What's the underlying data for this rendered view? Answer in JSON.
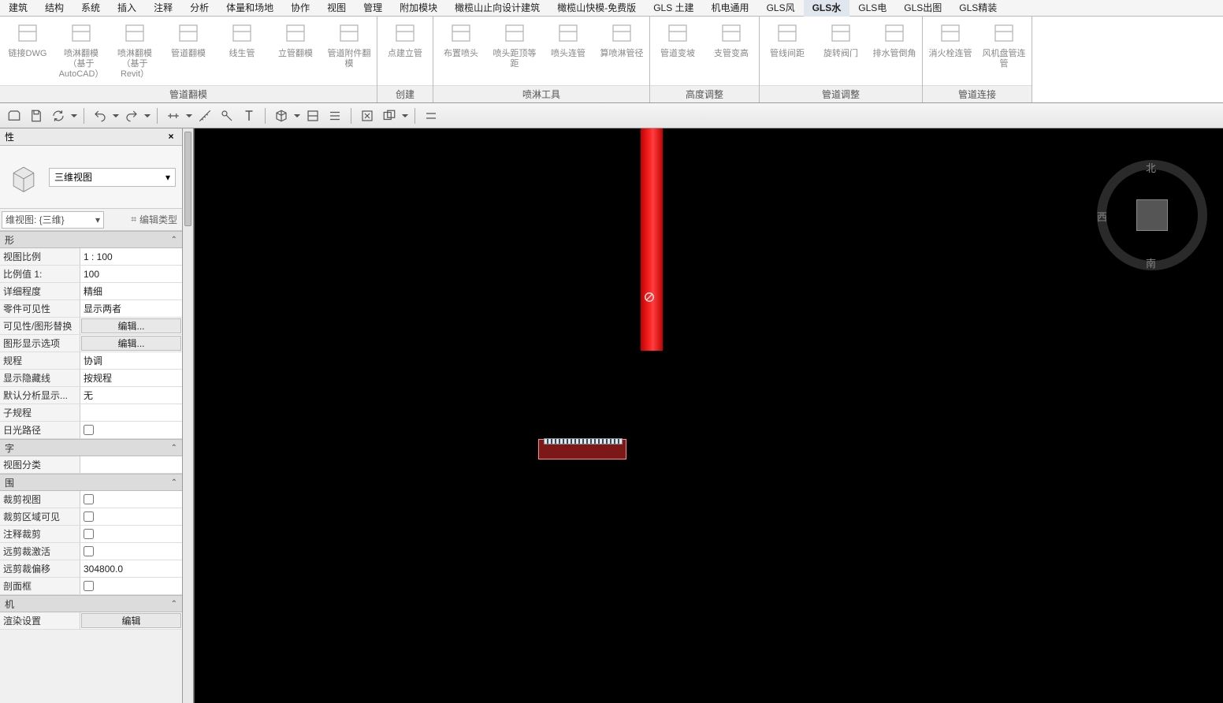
{
  "menu": {
    "items": [
      "建筑",
      "结构",
      "系统",
      "插入",
      "注释",
      "分析",
      "体量和场地",
      "协作",
      "视图",
      "管理",
      "附加模块",
      "橄榄山止向设计建筑",
      "橄榄山快模-免费版",
      "GLS 土建",
      "机电通用",
      "GLS风",
      "GLS水",
      "GLS电",
      "GLS出图",
      "GLS精装"
    ],
    "active": 16
  },
  "ribbon": {
    "groups": [
      {
        "label": "管道翻模",
        "buttons": [
          {
            "name": "link-dwg",
            "label": "链接DWG"
          },
          {
            "name": "spray-autocad",
            "label": "喷淋翻模\n（基于AutoCAD）"
          },
          {
            "name": "spray-revit",
            "label": "喷淋翻模\n（基于Revit）"
          },
          {
            "name": "pipe-flip",
            "label": "管道翻模"
          },
          {
            "name": "line-pipe",
            "label": "线生管"
          },
          {
            "name": "riser-flip",
            "label": "立管翻模"
          },
          {
            "name": "pipe-acc-flip",
            "label": "管道附件翻模"
          }
        ]
      },
      {
        "label": "创建",
        "buttons": [
          {
            "name": "point-riser",
            "label": "点建立管"
          }
        ]
      },
      {
        "label": "喷淋工具",
        "buttons": [
          {
            "name": "place-spray",
            "label": "布置喷头"
          },
          {
            "name": "spray-top-dist",
            "label": "喷头距顶等距"
          },
          {
            "name": "spray-connect",
            "label": "喷头连管"
          },
          {
            "name": "calc-spray-dia",
            "label": "算喷淋管径"
          }
        ]
      },
      {
        "label": "高度调整",
        "buttons": [
          {
            "name": "pipe-slope",
            "label": "管道变坡"
          },
          {
            "name": "branch-height",
            "label": "支管变高"
          }
        ]
      },
      {
        "label": "管道调整",
        "buttons": [
          {
            "name": "pipe-gap",
            "label": "管线间距"
          },
          {
            "name": "rotate-valve",
            "label": "旋转阀门"
          },
          {
            "name": "drain-chamfer",
            "label": "排水管倒角"
          }
        ]
      },
      {
        "label": "管道连接",
        "buttons": [
          {
            "name": "hydrant-connect",
            "label": "消火栓连管"
          },
          {
            "name": "fcu-connect",
            "label": "风机盘管连管"
          }
        ]
      }
    ]
  },
  "props": {
    "title": "性",
    "type": "三维视图",
    "instance": "维视图: {三维}",
    "edittype": "编辑类型",
    "categories": [
      {
        "name": "形",
        "rows": [
          {
            "k": "视图比例",
            "v": "1 : 100"
          },
          {
            "k": "比例值 1:",
            "v": "100"
          },
          {
            "k": "详细程度",
            "v": "精细"
          },
          {
            "k": "零件可见性",
            "v": "显示两者"
          },
          {
            "k": "可见性/图形替换",
            "v": "编辑...",
            "btn": true
          },
          {
            "k": "图形显示选项",
            "v": "编辑...",
            "btn": true
          },
          {
            "k": "规程",
            "v": "协调"
          },
          {
            "k": "显示隐藏线",
            "v": "按规程"
          },
          {
            "k": "默认分析显示...",
            "v": "无"
          },
          {
            "k": "子规程",
            "v": ""
          },
          {
            "k": "日光路径",
            "v": "",
            "chk": true
          }
        ]
      },
      {
        "name": "字",
        "rows": [
          {
            "k": "视图分类",
            "v": ""
          }
        ]
      },
      {
        "name": "围",
        "rows": [
          {
            "k": "裁剪视图",
            "v": "",
            "chk": true
          },
          {
            "k": "裁剪区域可见",
            "v": "",
            "chk": true
          },
          {
            "k": "注释裁剪",
            "v": "",
            "chk": true
          },
          {
            "k": "远剪裁激活",
            "v": "",
            "chk": true
          },
          {
            "k": "远剪裁偏移",
            "v": "304800.0"
          },
          {
            "k": "剖面框",
            "v": "",
            "chk": true
          }
        ]
      },
      {
        "name": "机",
        "rows": [
          {
            "k": "渲染设置",
            "v": "编辑",
            "btn": true
          }
        ]
      }
    ]
  },
  "nav": {
    "n": "北",
    "w": "西",
    "s": "南"
  }
}
